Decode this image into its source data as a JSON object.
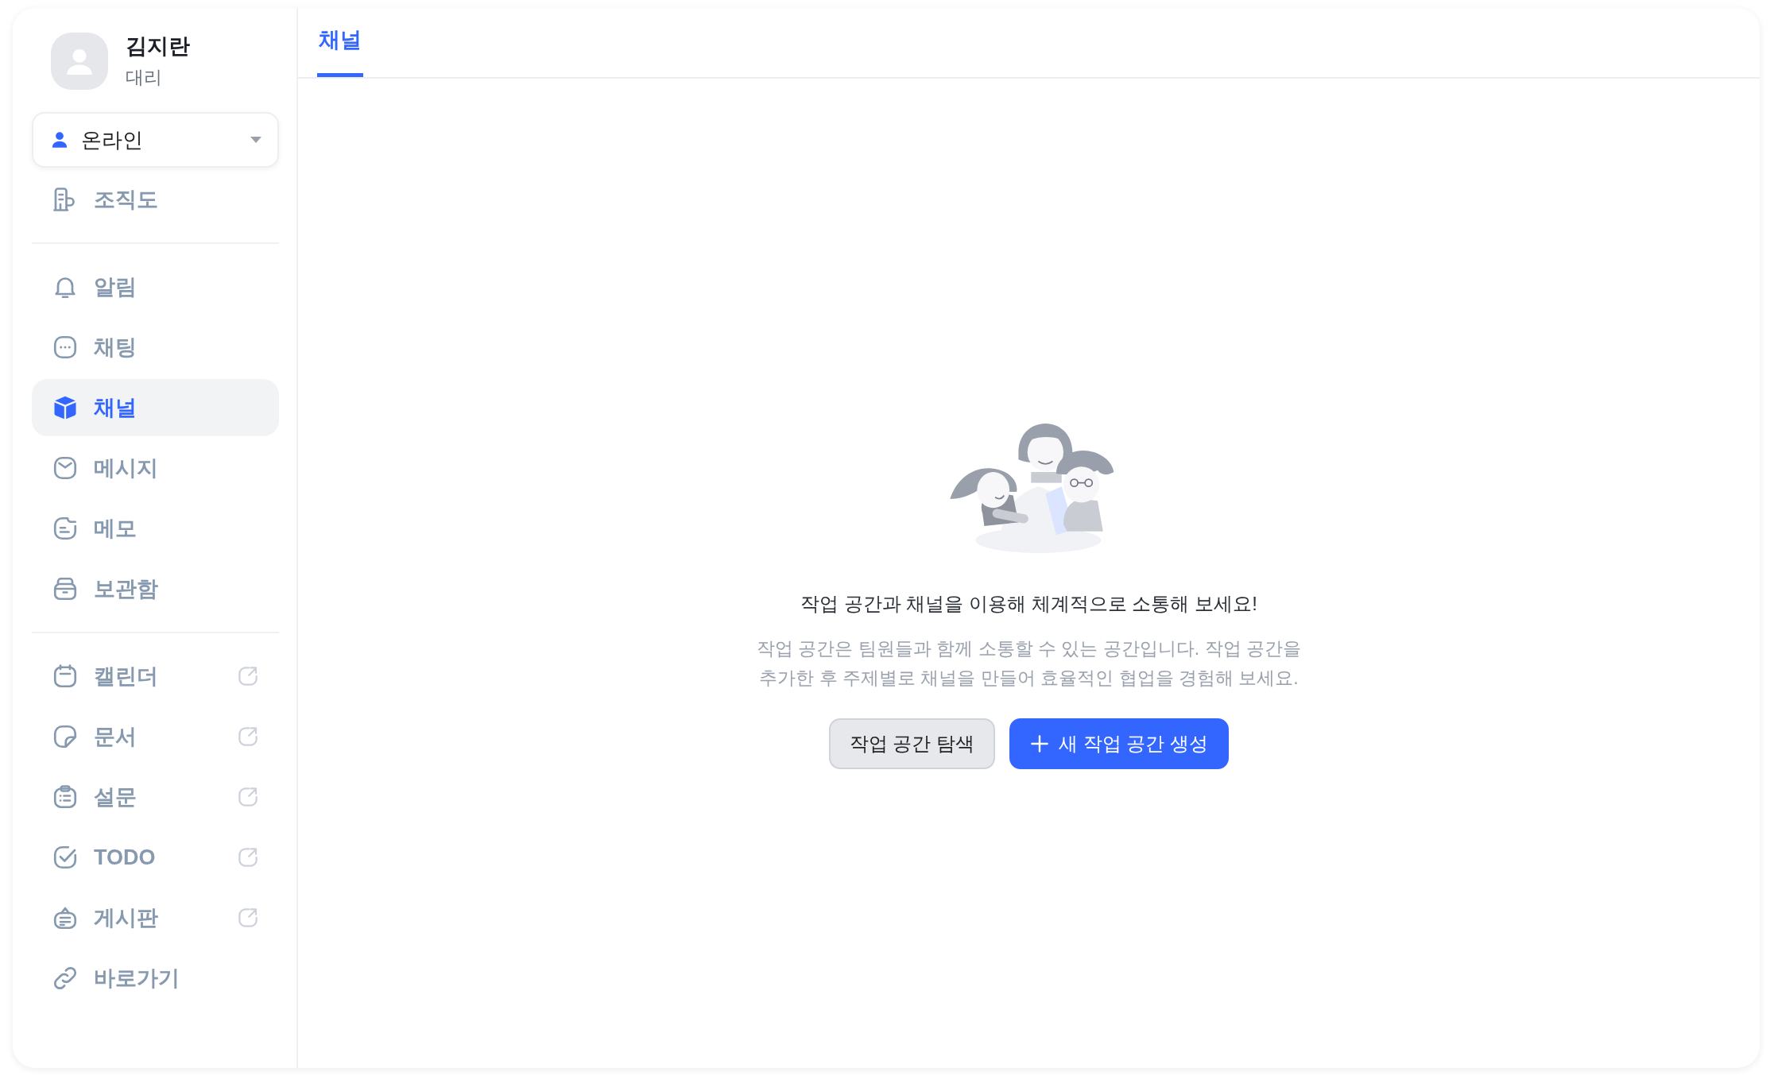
{
  "sidebar": {
    "profile": {
      "name": "김지란",
      "title": "대리"
    },
    "status": {
      "label": "온라인"
    },
    "groups": [
      {
        "items": [
          {
            "label": "조직도",
            "selected": false,
            "external": false
          }
        ]
      },
      {
        "items": [
          {
            "label": "알림",
            "selected": false,
            "external": false
          },
          {
            "label": "채팅",
            "selected": false,
            "external": false
          },
          {
            "label": "채널",
            "selected": true,
            "external": false
          },
          {
            "label": "메시지",
            "selected": false,
            "external": false
          },
          {
            "label": "메모",
            "selected": false,
            "external": false
          },
          {
            "label": "보관함",
            "selected": false,
            "external": false
          }
        ]
      },
      {
        "items": [
          {
            "label": "캘린더",
            "selected": false,
            "external": true
          },
          {
            "label": "문서",
            "selected": false,
            "external": true
          },
          {
            "label": "설문",
            "selected": false,
            "external": true
          },
          {
            "label": "TODO",
            "selected": false,
            "external": true
          },
          {
            "label": "게시판",
            "selected": false,
            "external": true
          },
          {
            "label": "바로가기",
            "selected": false,
            "external": false
          }
        ]
      }
    ]
  },
  "tabs": [
    {
      "label": "채널",
      "selected": true
    }
  ],
  "empty_state": {
    "heading": "작업 공간과 채널을 이용해 체계적으로 소통해 보세요!",
    "description_lines": [
      "작업 공간은 팀원들과 함께 소통할 수 있는 공간입니다. 작업 공간을",
      "추가한 후 주제별로 채널을 만들어 효율적인 협업을 경험해 보세요."
    ],
    "buttons": [
      {
        "kind": "secondary",
        "label": "작업 공간 탐색"
      },
      {
        "kind": "primary",
        "label": "새 작업 공간 생성"
      }
    ]
  }
}
